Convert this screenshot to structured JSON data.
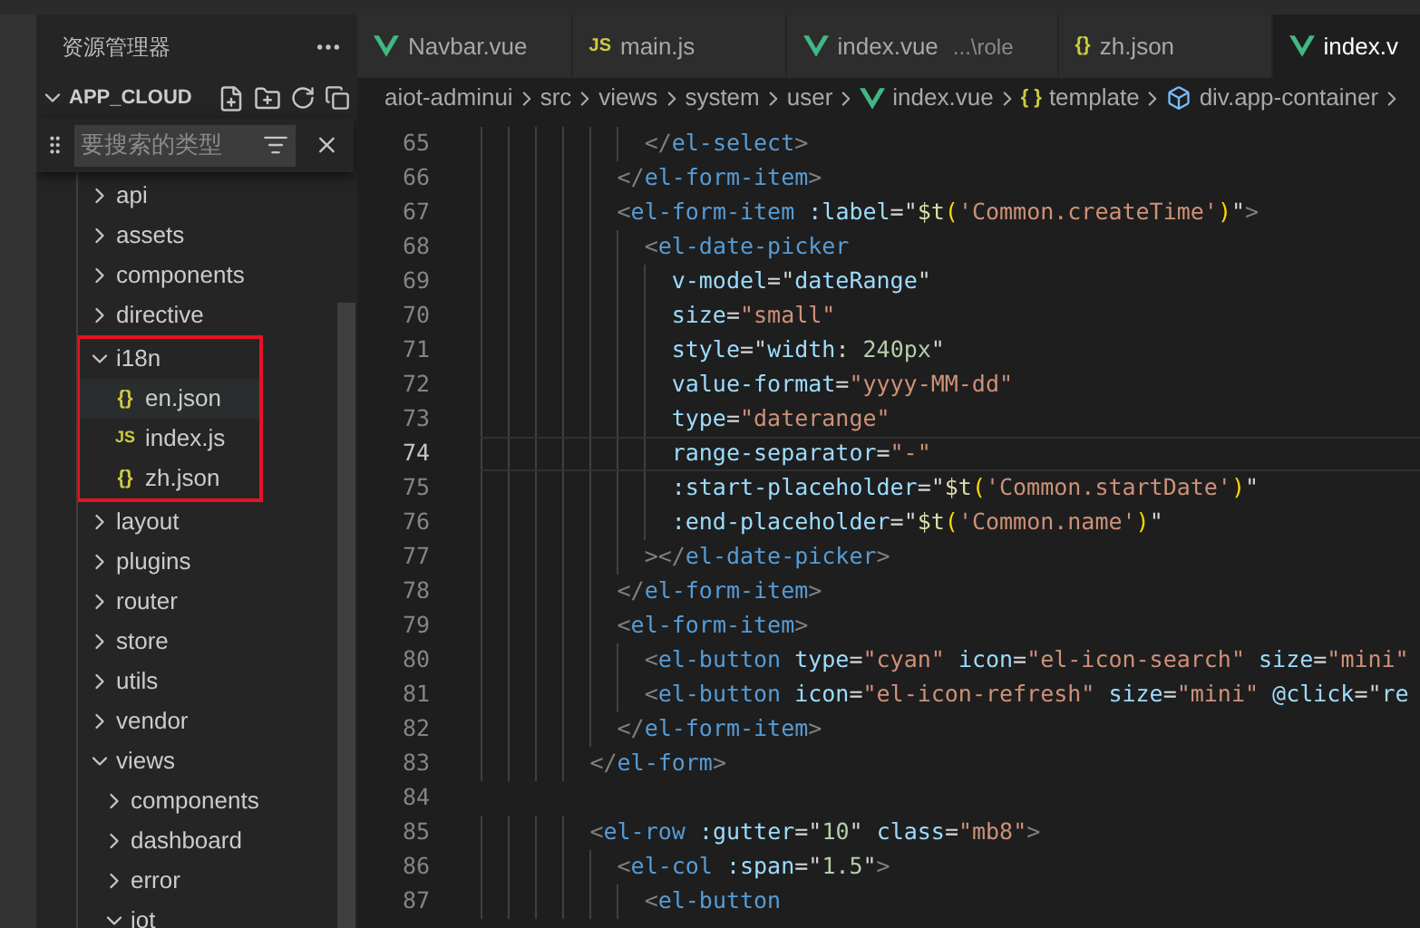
{
  "sidebar": {
    "title": "资源管理器",
    "root": {
      "label": "APP_CLOUD",
      "expanded": true
    },
    "find": {
      "placeholder": "要搜索的类型"
    },
    "tree": [
      {
        "label": "api",
        "kind": "folder",
        "expanded": false
      },
      {
        "label": "assets",
        "kind": "folder",
        "expanded": false
      },
      {
        "label": "components",
        "kind": "folder",
        "expanded": false
      },
      {
        "label": "directive",
        "kind": "folder",
        "expanded": false
      },
      {
        "label": "i18n",
        "kind": "folder",
        "expanded": true,
        "framed": true,
        "children": [
          {
            "label": "en.json",
            "kind": "json",
            "icon_text": "{}",
            "hovered": true
          },
          {
            "label": "index.js",
            "kind": "js",
            "icon_text": "JS",
            "hovered": false
          },
          {
            "label": "zh.json",
            "kind": "json",
            "icon_text": "{}",
            "hovered": false
          }
        ]
      },
      {
        "label": "layout",
        "kind": "folder",
        "expanded": false
      },
      {
        "label": "plugins",
        "kind": "folder",
        "expanded": false
      },
      {
        "label": "router",
        "kind": "folder",
        "expanded": false
      },
      {
        "label": "store",
        "kind": "folder",
        "expanded": false
      },
      {
        "label": "utils",
        "kind": "folder",
        "expanded": false
      },
      {
        "label": "vendor",
        "kind": "folder",
        "expanded": false
      },
      {
        "label": "views",
        "kind": "folder",
        "expanded": true,
        "children": [
          {
            "label": "components",
            "kind": "folder",
            "expanded": false
          },
          {
            "label": "dashboard",
            "kind": "folder",
            "expanded": false
          },
          {
            "label": "error",
            "kind": "folder",
            "expanded": false
          },
          {
            "label": "iot",
            "kind": "folder",
            "expanded": true
          }
        ]
      }
    ]
  },
  "tabs": [
    {
      "label": "Navbar.vue",
      "kind": "vue",
      "selected": false
    },
    {
      "label": "main.js",
      "kind": "js",
      "icon_text": "JS",
      "selected": false
    },
    {
      "label": "index.vue",
      "description": "...\\role",
      "kind": "vue",
      "selected": false
    },
    {
      "label": "zh.json",
      "kind": "json",
      "icon_text": "{}",
      "selected": false
    },
    {
      "label": "index.v",
      "kind": "vue",
      "selected": true
    }
  ],
  "breadcrumb": [
    {
      "label": "aiot-adminui",
      "kind": "folder"
    },
    {
      "label": "src",
      "kind": "folder"
    },
    {
      "label": "views",
      "kind": "folder"
    },
    {
      "label": "system",
      "kind": "folder"
    },
    {
      "label": "user",
      "kind": "folder"
    },
    {
      "label": "index.vue",
      "kind": "vue"
    },
    {
      "label": "template",
      "kind": "json",
      "icon_text": "{ }"
    },
    {
      "label": "div.app-container",
      "kind": "element"
    }
  ],
  "code": [
    {
      "n": "65",
      "current": false,
      "text": "            </el-select>"
    },
    {
      "n": "66",
      "current": false,
      "text": "          </el-form-item>"
    },
    {
      "n": "67",
      "current": false,
      "text": "          <el-form-item :label=\"$t('Common.createTime')\">"
    },
    {
      "n": "68",
      "current": false,
      "text": "            <el-date-picker"
    },
    {
      "n": "69",
      "current": false,
      "text": "              v-model=\"dateRange\""
    },
    {
      "n": "70",
      "current": false,
      "text": "              size=\"small\""
    },
    {
      "n": "71",
      "current": false,
      "text": "              style=\"width: 240px\""
    },
    {
      "n": "72",
      "current": false,
      "text": "              value-format=\"yyyy-MM-dd\""
    },
    {
      "n": "73",
      "current": false,
      "text": "              type=\"daterange\""
    },
    {
      "n": "74",
      "current": true,
      "text": "              range-separator=\"-\""
    },
    {
      "n": "75",
      "current": false,
      "text": "              :start-placeholder=\"$t('Common.startDate')\""
    },
    {
      "n": "76",
      "current": false,
      "text": "              :end-placeholder=\"$t('Common.name')\""
    },
    {
      "n": "77",
      "current": false,
      "text": "            ></el-date-picker>"
    },
    {
      "n": "78",
      "current": false,
      "text": "          </el-form-item>"
    },
    {
      "n": "79",
      "current": false,
      "text": "          <el-form-item>"
    },
    {
      "n": "80",
      "current": false,
      "text": "            <el-button type=\"cyan\" icon=\"el-icon-search\" size=\"mini\""
    },
    {
      "n": "81",
      "current": false,
      "text": "            <el-button icon=\"el-icon-refresh\" size=\"mini\" @click=\"re"
    },
    {
      "n": "82",
      "current": false,
      "text": "          </el-form-item>"
    },
    {
      "n": "83",
      "current": false,
      "text": "        </el-form>"
    },
    {
      "n": "84",
      "current": false
    },
    {
      "n": "85",
      "current": false,
      "text": "        <el-row :gutter=\"10\" class=\"mb8\">"
    },
    {
      "n": "86",
      "current": false,
      "text": "          <el-col :span=\"1.5\">"
    },
    {
      "n": "87",
      "current": false,
      "text": "            <el-button"
    }
  ]
}
